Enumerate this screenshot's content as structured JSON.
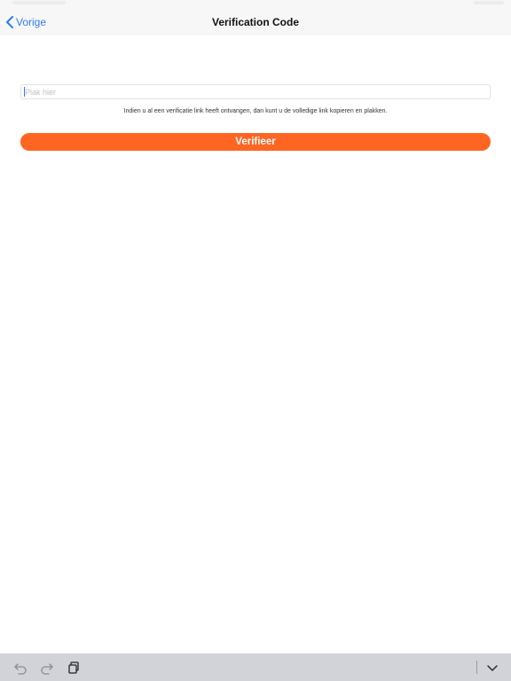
{
  "nav": {
    "back_label": "Vorige",
    "title": "Verification Code"
  },
  "form": {
    "input_placeholder": "Plak hier",
    "input_value": "",
    "hint": "Indien u al een verificatie link heeft ontvangen, dan kunt u de volledige link kopieren en plakken.",
    "verify_label": "Verifieer"
  },
  "accessory_bar": {
    "icons": [
      "undo-icon",
      "redo-icon",
      "paste-icon",
      "keyboard-dismiss-icon"
    ]
  },
  "colors": {
    "accent_blue": "#2f7cf6",
    "button_orange": "#fd6522",
    "nav_background": "#f7f7f7",
    "accessory_background": "#d1d3d9"
  }
}
